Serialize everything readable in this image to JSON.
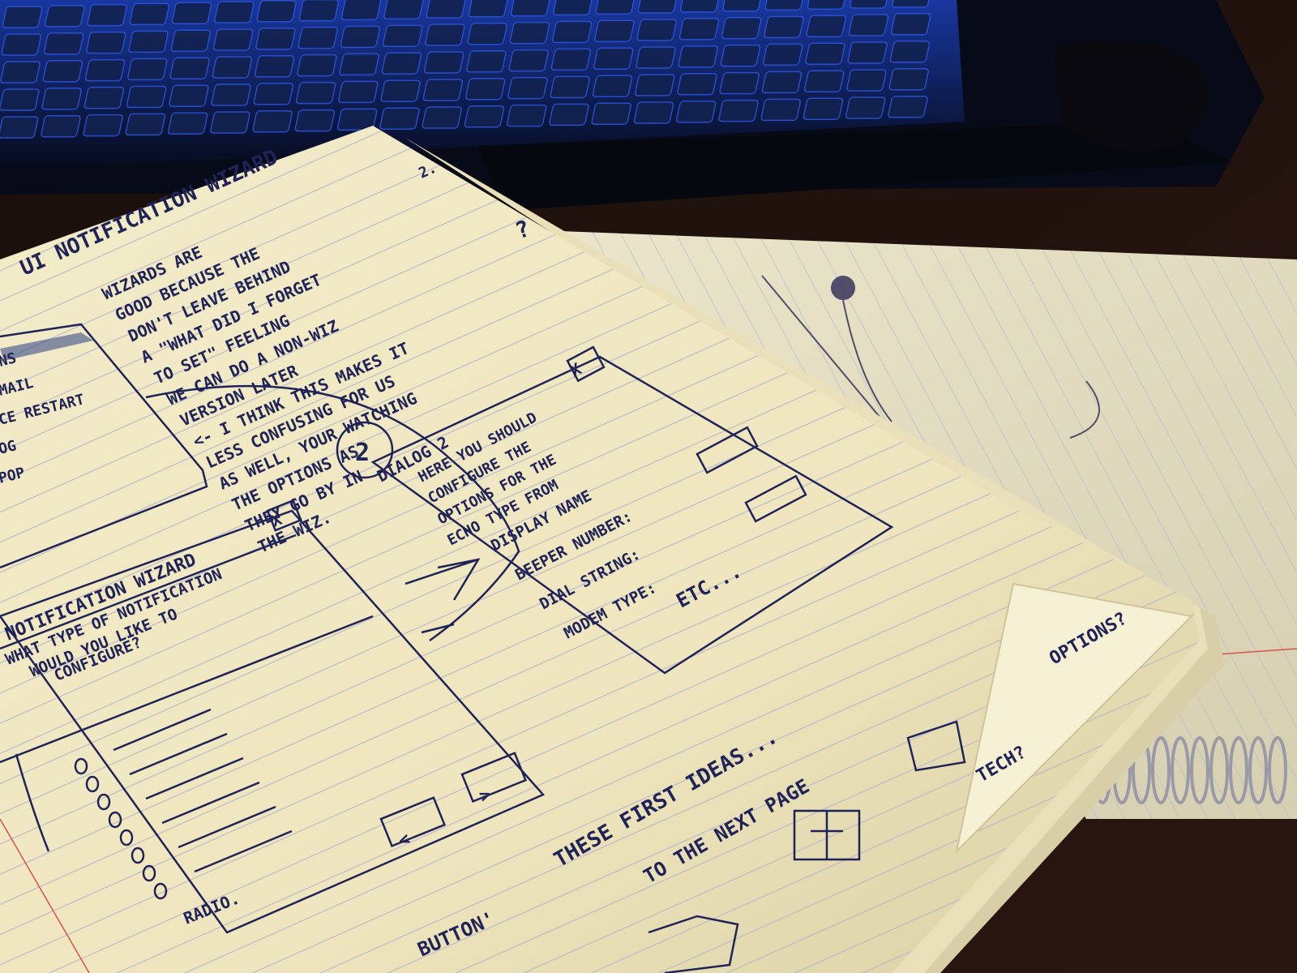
{
  "scene": {
    "description_label": "photo-notebook-ui-sketches",
    "colors": {
      "keyboard_blue": "#1b3fb8",
      "keyboard_dark": "#0b0f1f",
      "paper": "#efe7c3",
      "paper_shadow": "#cfc49a",
      "ink": "#1f2358",
      "margin_red": "#d9534f",
      "desk": "#2a1610"
    }
  },
  "page_left": {
    "title": "UI  NOTIFICATION WIZARD",
    "page_number": "2.",
    "notes": [
      "WIZARDS ARE",
      "GOOD BECAUSE THE",
      "DON'T LEAVE BEHIND",
      "A \"WHAT DID I FORGET",
      "TO SET\" FEELING",
      "WE CAN DO A NON-WIZ",
      "VERSION LATER",
      "<- I THINK THIS MAKES IT",
      "LESS CONFUSING FOR US",
      "AS WELL, YOUR WATCHING",
      "THE OPTIONS AS",
      "THEY GO BY IN",
      "THE WIZ."
    ],
    "question_mark": "?",
    "old_window_items": [
      "NS",
      "MAIL",
      "CE RESTART",
      "OG",
      "POP"
    ],
    "wizard_window": {
      "title": "NOTIFICATION WIZARD",
      "close": "X",
      "prompt_lines": [
        "WHAT TYPE OF NOTIFICATION",
        "WOULD YOU LIKE TO",
        "CONFIGURE?"
      ],
      "footer": "RADIO.",
      "button_back": "<",
      "button_next": ">"
    },
    "step_marker": "2",
    "dialog": {
      "title": "DIALOG 2",
      "close": "X",
      "intro": [
        "HERE YOU SHOULD",
        "CONFIGURE THE",
        "OPTIONS FOR THE",
        "ECHO TYPE FROM"
      ],
      "fields": [
        "DISPLAY NAME",
        "BEEPER NUMBER:",
        "DIAL STRING:",
        "MODEM TYPE:"
      ],
      "etc": "ETC..."
    },
    "bottom_notes": [
      "BUTTON'",
      "THESE FIRST IDEAS...",
      "TO THE NEXT PAGE",
      "OPTIONS?",
      "TECH?"
    ]
  }
}
